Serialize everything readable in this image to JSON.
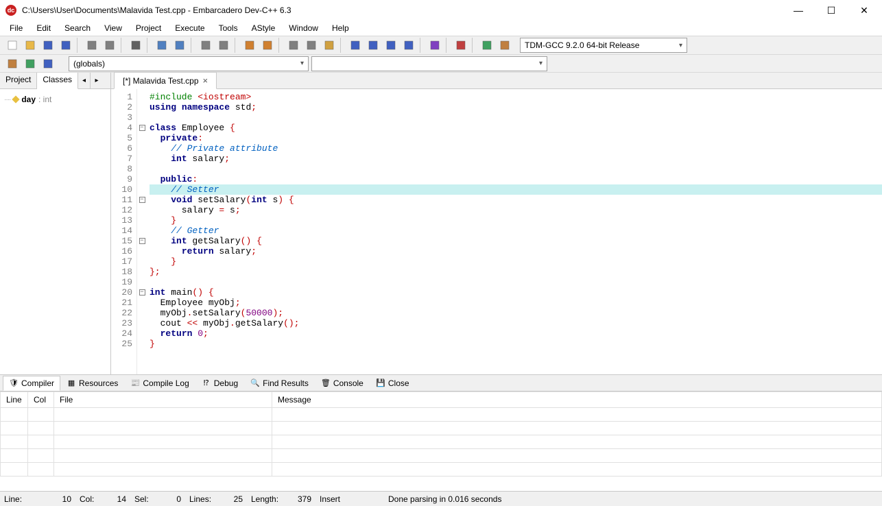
{
  "title": "C:\\Users\\User\\Documents\\Malavida Test.cpp - Embarcadero Dev-C++ 6.3",
  "menus": [
    "File",
    "Edit",
    "Search",
    "View",
    "Project",
    "Execute",
    "Tools",
    "AStyle",
    "Window",
    "Help"
  ],
  "compiler_combo": "TDM-GCC 9.2.0 64-bit Release",
  "scope_combo": "(globals)",
  "sidebar": {
    "tabs": [
      "Project",
      "Classes"
    ],
    "active_tab": "Classes",
    "tree": {
      "var": "day",
      "type": ": int"
    }
  },
  "file_tab": "[*] Malavida Test.cpp",
  "code": {
    "highlight_line": 10,
    "lines": [
      {
        "n": 1,
        "fold": "",
        "html": "<span class='pp'>#include</span> <span class='ang'>&lt;iostream&gt;</span>"
      },
      {
        "n": 2,
        "fold": "",
        "html": "<span class='kw'>using</span> <span class='kw'>namespace</span> std<span class='pn'>;</span>"
      },
      {
        "n": 3,
        "fold": "",
        "html": ""
      },
      {
        "n": 4,
        "fold": "minus",
        "html": "<span class='kw'>class</span> Employee <span class='pn'>{</span>"
      },
      {
        "n": 5,
        "fold": "",
        "html": "  <span class='kw'>private</span><span class='pn'>:</span>"
      },
      {
        "n": 6,
        "fold": "",
        "html": "    <span class='cm'>// Private attribute</span>"
      },
      {
        "n": 7,
        "fold": "",
        "html": "    <span class='kw'>int</span> salary<span class='pn'>;</span>"
      },
      {
        "n": 8,
        "fold": "",
        "html": ""
      },
      {
        "n": 9,
        "fold": "",
        "html": "  <span class='kw'>public</span><span class='pn'>:</span>"
      },
      {
        "n": 10,
        "fold": "",
        "html": "    <span class='cm'>// Setter</span>"
      },
      {
        "n": 11,
        "fold": "minus",
        "html": "    <span class='kw'>void</span> setSalary<span class='pn'>(</span><span class='kw'>int</span> s<span class='pn'>)</span> <span class='pn'>{</span>"
      },
      {
        "n": 12,
        "fold": "",
        "html": "      salary <span class='pn'>=</span> s<span class='pn'>;</span>"
      },
      {
        "n": 13,
        "fold": "",
        "html": "    <span class='pn'>}</span>"
      },
      {
        "n": 14,
        "fold": "",
        "html": "    <span class='cm'>// Getter</span>"
      },
      {
        "n": 15,
        "fold": "minus",
        "html": "    <span class='kw'>int</span> getSalary<span class='pn'>()</span> <span class='pn'>{</span>"
      },
      {
        "n": 16,
        "fold": "",
        "html": "      <span class='kw'>return</span> salary<span class='pn'>;</span>"
      },
      {
        "n": 17,
        "fold": "",
        "html": "    <span class='pn'>}</span>"
      },
      {
        "n": 18,
        "fold": "",
        "html": "<span class='pn'>};</span>"
      },
      {
        "n": 19,
        "fold": "",
        "html": ""
      },
      {
        "n": 20,
        "fold": "minus",
        "html": "<span class='kw'>int</span> main<span class='pn'>()</span> <span class='pn'>{</span>"
      },
      {
        "n": 21,
        "fold": "",
        "html": "  Employee myObj<span class='pn'>;</span>"
      },
      {
        "n": 22,
        "fold": "",
        "html": "  myObj<span class='pn'>.</span>setSalary<span class='pn'>(</span><span class='num'>50000</span><span class='pn'>);</span>"
      },
      {
        "n": 23,
        "fold": "",
        "html": "  cout <span class='pn'>&lt;&lt;</span> myObj<span class='pn'>.</span>getSalary<span class='pn'>();</span>"
      },
      {
        "n": 24,
        "fold": "",
        "html": "  <span class='kw'>return</span> <span class='num'>0</span><span class='pn'>;</span>"
      },
      {
        "n": 25,
        "fold": "",
        "html": "<span class='pn'>}</span>"
      }
    ]
  },
  "bottom": {
    "tabs": [
      "Compiler",
      "Resources",
      "Compile Log",
      "Debug",
      "Find Results",
      "Console",
      "Close"
    ],
    "active": "Compiler",
    "columns": [
      "Line",
      "Col",
      "File",
      "Message"
    ]
  },
  "status": {
    "line_label": "Line:",
    "line_val": "10",
    "col_label": "Col:",
    "col_val": "14",
    "sel_label": "Sel:",
    "sel_val": "0",
    "lines_label": "Lines:",
    "lines_val": "25",
    "len_label": "Length:",
    "len_val": "379",
    "mode": "Insert",
    "msg": "Done parsing in 0.016 seconds"
  },
  "toolbar_icons": [
    "new",
    "open",
    "save",
    "saveall",
    "sep",
    "cut",
    "copy",
    "sep",
    "print",
    "sep",
    "find",
    "replace",
    "sep",
    "bookmark",
    "bookmarks",
    "sep",
    "undo",
    "redo",
    "sep",
    "compile",
    "run",
    "stop",
    "sep",
    "grid1",
    "grid2",
    "grid3",
    "grid4",
    "sep",
    "check",
    "sep",
    "cancel",
    "sep",
    "chart",
    "insert"
  ],
  "row2_icons": [
    "goto-def",
    "goto-decl",
    "toggle-panel"
  ]
}
